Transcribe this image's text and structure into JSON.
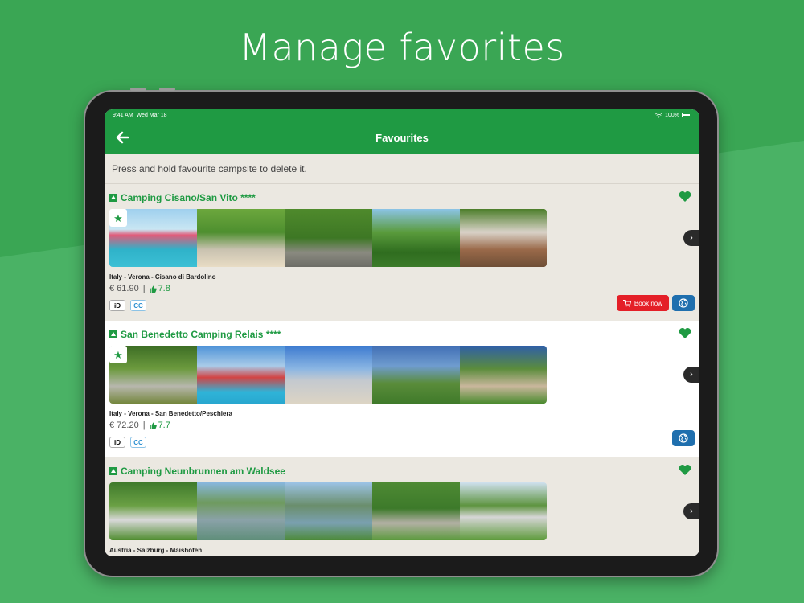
{
  "headline": "Manage favorites",
  "status_bar": {
    "time": "9:41 AM",
    "date": "Wed Mar 18",
    "battery": "100%"
  },
  "nav": {
    "title": "Favourites",
    "back_icon": "arrow-left-icon"
  },
  "hint": "Press and hold favourite campsite to delete it.",
  "colors": {
    "brand_green": "#1f9a43",
    "book_red": "#e41f27",
    "web_blue": "#1f6fae"
  },
  "campsites": [
    {
      "name": "Camping Cisano/San Vito ****",
      "location": "Italy  - Verona - Cisano di Bardolino",
      "price": "€ 61.90",
      "separator": "|",
      "rating": "7.8",
      "badges": [
        "iD",
        "CC"
      ],
      "book_label": "Book now",
      "favorite": true
    },
    {
      "name": "San Benedetto Camping Relais ****",
      "location": "Italy  - Verona - San Benedetto/Peschiera",
      "price": "€ 72.20",
      "separator": "|",
      "rating": "7.7",
      "badges": [
        "iD",
        "CC"
      ],
      "favorite": true
    },
    {
      "name": "Camping Neunbrunnen am Waldsee",
      "location": "Austria  - Salzburg - Maishofen",
      "favorite": true
    }
  ]
}
